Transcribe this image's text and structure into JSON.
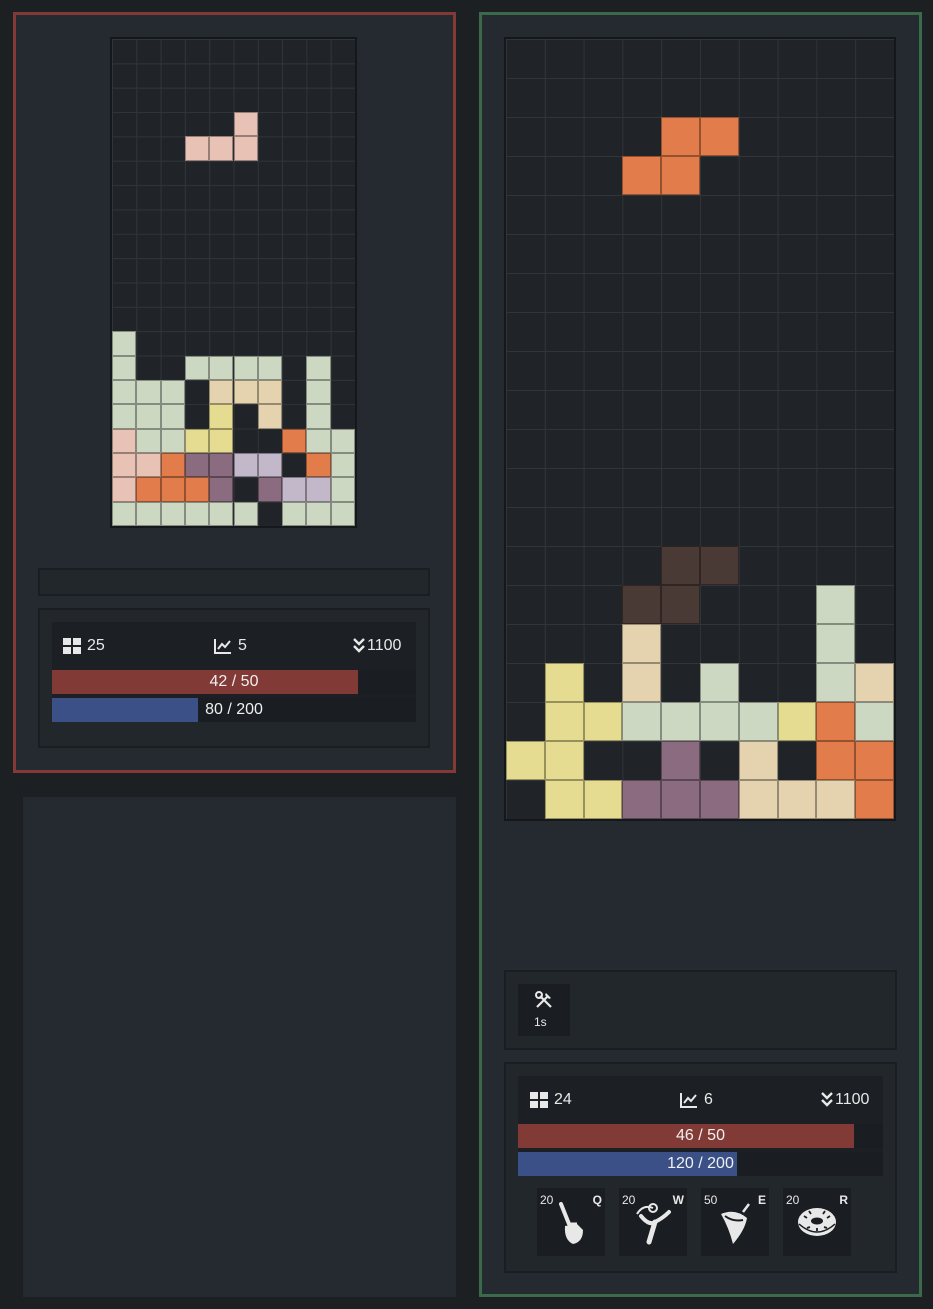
{
  "players": [
    {
      "cols": 10,
      "rows": 20,
      "stats": {
        "pieces": "25",
        "lines": "5",
        "drop_speed": "1100"
      },
      "hp": {
        "value": 42,
        "max": 50,
        "label": "42 / 50"
      },
      "mana": {
        "value": 80,
        "max": 200,
        "label": "80 / 200"
      },
      "cells": [
        [
          5,
          3,
          "#e8c3b5"
        ],
        [
          3,
          4,
          "#e8c3b5"
        ],
        [
          4,
          4,
          "#e8c3b5"
        ],
        [
          5,
          4,
          "#e8c3b5"
        ],
        [
          0,
          12,
          "#cdd8c3"
        ],
        [
          0,
          13,
          "#cdd8c3"
        ],
        [
          3,
          13,
          "#cdd8c3"
        ],
        [
          4,
          13,
          "#cdd8c3"
        ],
        [
          5,
          13,
          "#cdd8c3"
        ],
        [
          6,
          13,
          "#cdd8c3"
        ],
        [
          8,
          13,
          "#cdd8c3"
        ],
        [
          0,
          14,
          "#cdd8c3"
        ],
        [
          1,
          14,
          "#cdd8c3"
        ],
        [
          2,
          14,
          "#cdd8c3"
        ],
        [
          4,
          14,
          "#e4d3ae"
        ],
        [
          5,
          14,
          "#e4d3ae"
        ],
        [
          6,
          14,
          "#e4d3ae"
        ],
        [
          8,
          14,
          "#cdd8c3"
        ],
        [
          0,
          15,
          "#cdd8c3"
        ],
        [
          1,
          15,
          "#cdd8c3"
        ],
        [
          2,
          15,
          "#cdd8c3"
        ],
        [
          4,
          15,
          "#e6dc91"
        ],
        [
          6,
          15,
          "#e4d3ae"
        ],
        [
          8,
          15,
          "#cdd8c3"
        ],
        [
          0,
          16,
          "#e8c3b5"
        ],
        [
          1,
          16,
          "#cdd8c3"
        ],
        [
          2,
          16,
          "#cdd8c3"
        ],
        [
          3,
          16,
          "#e6dc91"
        ],
        [
          4,
          16,
          "#e6dc91"
        ],
        [
          7,
          16,
          "#e27d4b"
        ],
        [
          8,
          16,
          "#cdd8c3"
        ],
        [
          9,
          16,
          "#cdd8c3"
        ],
        [
          0,
          17,
          "#e8c3b5"
        ],
        [
          1,
          17,
          "#e8c3b5"
        ],
        [
          2,
          17,
          "#e27d4b"
        ],
        [
          3,
          17,
          "#8a6b7f"
        ],
        [
          4,
          17,
          "#8a6b7f"
        ],
        [
          5,
          17,
          "#c3b8c9"
        ],
        [
          6,
          17,
          "#c3b8c9"
        ],
        [
          8,
          17,
          "#e27d4b"
        ],
        [
          9,
          17,
          "#cdd8c3"
        ],
        [
          0,
          18,
          "#e8c3b5"
        ],
        [
          1,
          18,
          "#e27d4b"
        ],
        [
          2,
          18,
          "#e27d4b"
        ],
        [
          3,
          18,
          "#e27d4b"
        ],
        [
          4,
          18,
          "#8a6b7f"
        ],
        [
          6,
          18,
          "#8a6b7f"
        ],
        [
          7,
          18,
          "#c3b8c9"
        ],
        [
          8,
          18,
          "#c3b8c9"
        ],
        [
          9,
          18,
          "#cdd8c3"
        ],
        [
          0,
          19,
          "#cdd8c3"
        ],
        [
          1,
          19,
          "#cdd8c3"
        ],
        [
          2,
          19,
          "#cdd8c3"
        ],
        [
          3,
          19,
          "#cdd8c3"
        ],
        [
          4,
          19,
          "#cdd8c3"
        ],
        [
          5,
          19,
          "#cdd8c3"
        ],
        [
          7,
          19,
          "#cdd8c3"
        ],
        [
          8,
          19,
          "#cdd8c3"
        ],
        [
          9,
          19,
          "#cdd8c3"
        ]
      ]
    },
    {
      "cols": 10,
      "rows": 20,
      "stats": {
        "pieces": "24",
        "lines": "6",
        "drop_speed": "1100"
      },
      "hp": {
        "value": 46,
        "max": 50,
        "label": "46 / 50"
      },
      "mana": {
        "value": 120,
        "max": 200,
        "label": "120 / 200"
      },
      "ability": {
        "icon": "tools-icon",
        "cooldown": "1s"
      },
      "skills": [
        {
          "cost": "20",
          "key": "Q",
          "icon": "shovel-icon"
        },
        {
          "cost": "20",
          "key": "W",
          "icon": "slingshot-icon"
        },
        {
          "cost": "50",
          "key": "E",
          "icon": "spinning-top-icon"
        },
        {
          "cost": "20",
          "key": "R",
          "icon": "donut-icon"
        }
      ],
      "cells": [
        [
          4,
          2,
          "#e27d4b"
        ],
        [
          5,
          2,
          "#e27d4b"
        ],
        [
          3,
          3,
          "#e27d4b"
        ],
        [
          4,
          3,
          "#e27d4b"
        ],
        [
          4,
          13,
          "#4a3a35"
        ],
        [
          5,
          13,
          "#4a3a35"
        ],
        [
          3,
          14,
          "#4a3a35"
        ],
        [
          4,
          14,
          "#4a3a35"
        ],
        [
          8,
          14,
          "#cdd8c3"
        ],
        [
          3,
          15,
          "#e4d3ae"
        ],
        [
          8,
          15,
          "#cdd8c3"
        ],
        [
          1,
          16,
          "#e6dc91"
        ],
        [
          3,
          16,
          "#e4d3ae"
        ],
        [
          5,
          16,
          "#cdd8c3"
        ],
        [
          8,
          16,
          "#cdd8c3"
        ],
        [
          9,
          16,
          "#e4d3ae"
        ],
        [
          1,
          17,
          "#e6dc91"
        ],
        [
          2,
          17,
          "#e6dc91"
        ],
        [
          3,
          17,
          "#cdd8c3"
        ],
        [
          4,
          17,
          "#cdd8c3"
        ],
        [
          5,
          17,
          "#cdd8c3"
        ],
        [
          6,
          17,
          "#cdd8c3"
        ],
        [
          7,
          17,
          "#e6dc91"
        ],
        [
          8,
          17,
          "#e27d4b"
        ],
        [
          9,
          17,
          "#cdd8c3"
        ],
        [
          0,
          18,
          "#e6dc91"
        ],
        [
          1,
          18,
          "#e6dc91"
        ],
        [
          4,
          18,
          "#8a6b7f"
        ],
        [
          6,
          18,
          "#e4d3ae"
        ],
        [
          8,
          18,
          "#e27d4b"
        ],
        [
          9,
          18,
          "#e27d4b"
        ],
        [
          1,
          19,
          "#e6dc91"
        ],
        [
          2,
          19,
          "#e6dc91"
        ],
        [
          3,
          19,
          "#8a6b7f"
        ],
        [
          4,
          19,
          "#8a6b7f"
        ],
        [
          5,
          19,
          "#8a6b7f"
        ],
        [
          6,
          19,
          "#e4d3ae"
        ],
        [
          7,
          19,
          "#e4d3ae"
        ],
        [
          8,
          19,
          "#e4d3ae"
        ],
        [
          9,
          19,
          "#e27d4b"
        ]
      ]
    }
  ]
}
